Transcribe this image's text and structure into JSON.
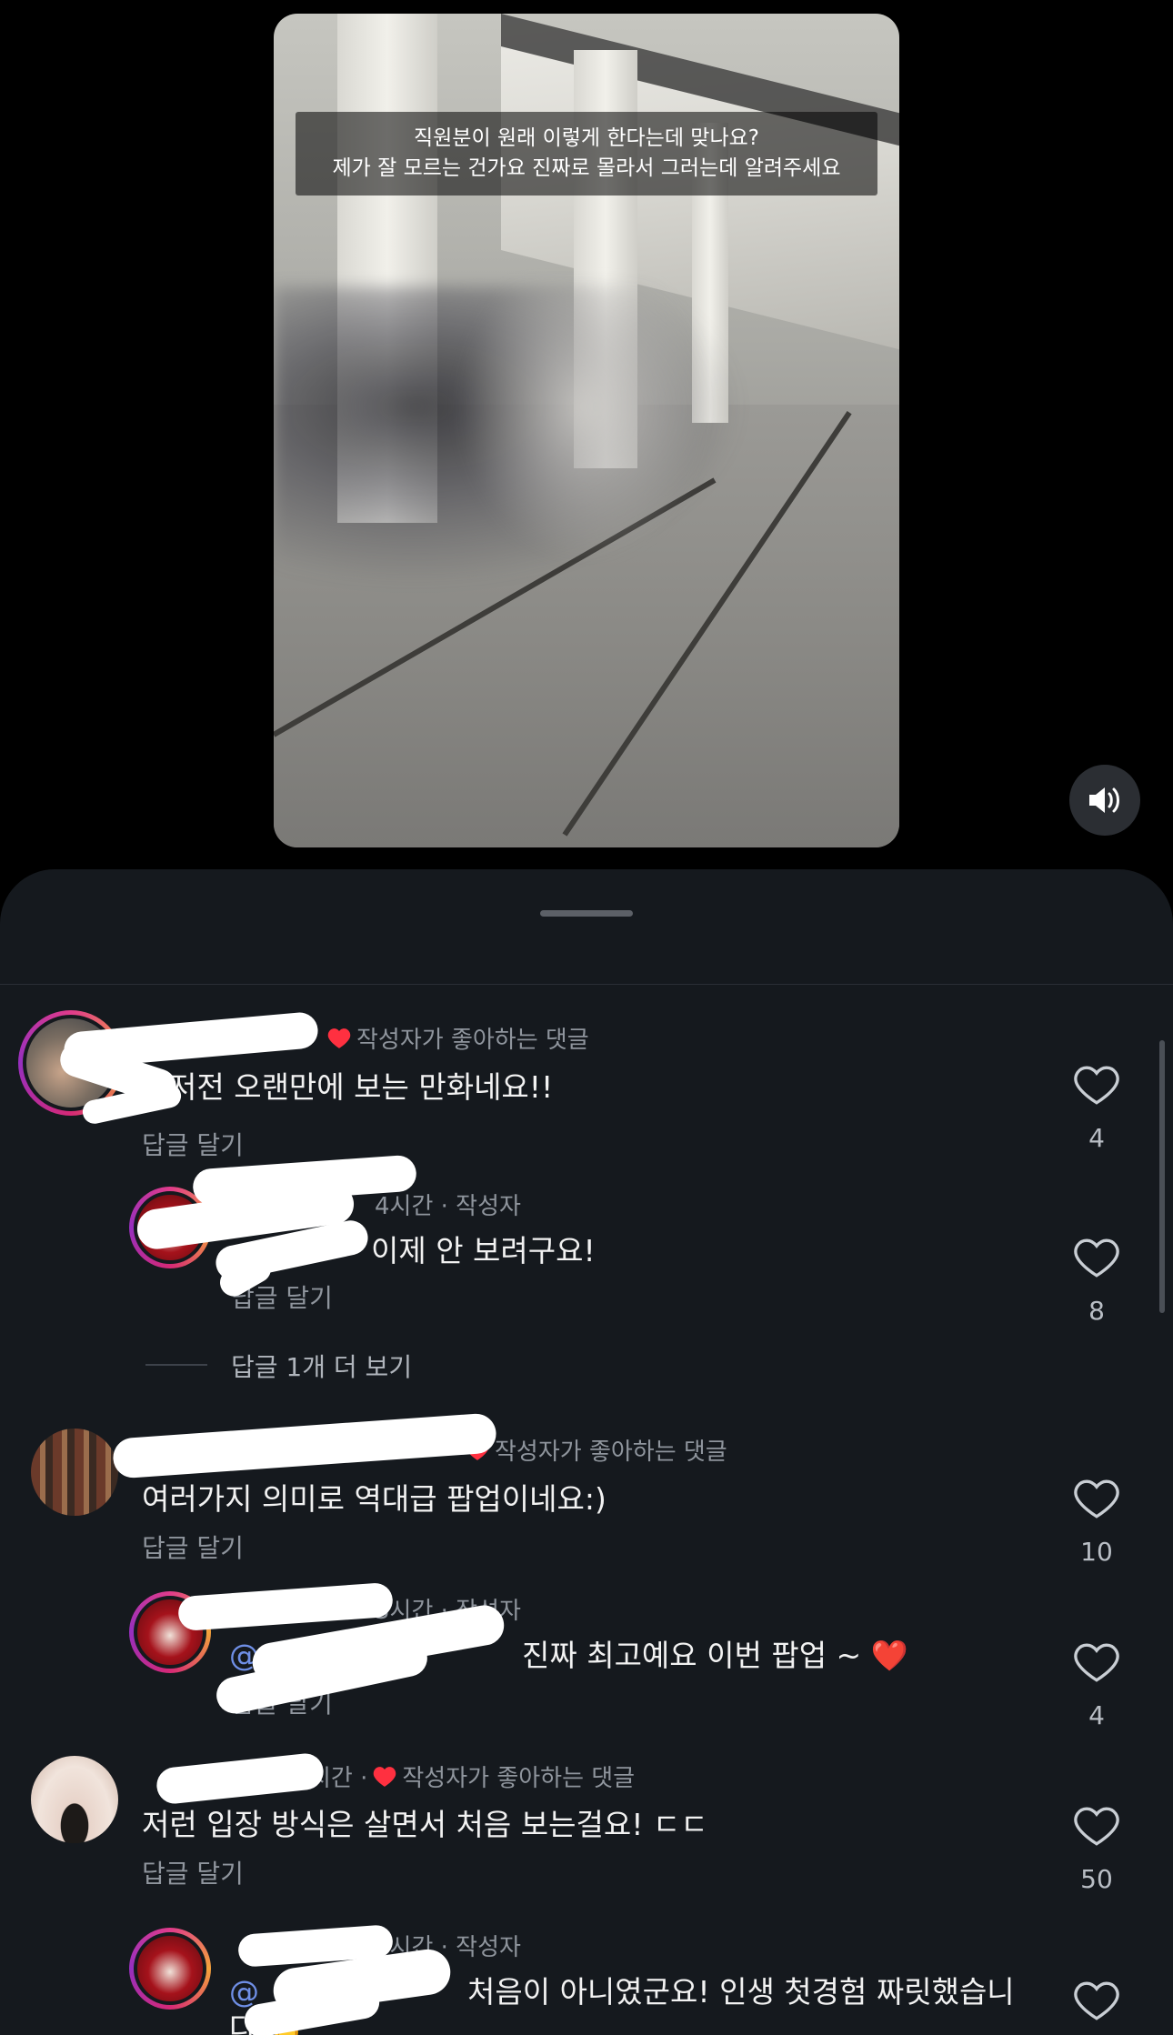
{
  "video": {
    "caption_line1": "직원분이 원래 이렇게 한다는데 맞나요?",
    "caption_line2": "제가 잘 모르는 건가요 진짜로 몰라서 그러는데 알려주세요"
  },
  "comments": [
    {
      "meta": "작성자가 좋아하는 댓글",
      "text": "저전 오랜만에 보는 만화네요!!",
      "reply_label": "답글 달기",
      "likes": "4"
    },
    {
      "meta": "4시간 · 작성자",
      "text": "이제 안 보려구요!",
      "reply_label": "답글 달기",
      "likes": "8"
    },
    {
      "meta": "작성자가 좋아하는 댓글",
      "text": "여러가지 의미로 역대급 팝업이네요:)",
      "reply_label": "답글 달기",
      "likes": "10"
    },
    {
      "meta": "3시간 · 작성자",
      "mention": "@",
      "text": "진짜 최고예요 이번 팝업 ~ ❤️",
      "reply_label": "답글 달기",
      "likes": "4"
    },
    {
      "meta": "시간 · ",
      "meta2": "작성자가 좋아하는 댓글",
      "text": "저런 입장 방식은 살면서 처음 보는걸요! ㄷㄷ",
      "reply_label": "답글 달기",
      "likes": "50"
    },
    {
      "meta": "3시간 · 작성자",
      "mention": "@",
      "text": "처음이 아니였군요! 인생 첫경험 짜릿했습니",
      "text2": "다 👏"
    }
  ],
  "more_replies": "답글 1개 더 보기"
}
